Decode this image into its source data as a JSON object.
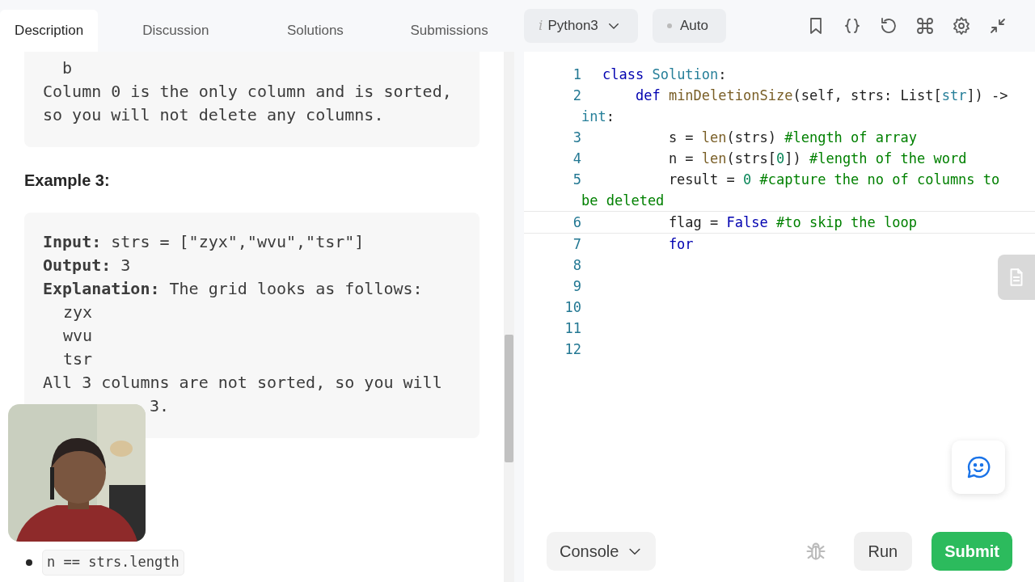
{
  "tabs": [
    {
      "label": "Description",
      "selected": true
    },
    {
      "label": "Discussion",
      "selected": false
    },
    {
      "label": "Solutions",
      "selected": false
    },
    {
      "label": "Submissions",
      "selected": false
    }
  ],
  "example_2_tail": [
    "  b",
    "Column 0 is the only column and is sorted,",
    "so you will not delete any columns."
  ],
  "example_3": {
    "heading": "Example 3:",
    "input_line": "**Input:** strs = [\"zyx\",\"wvu\",\"tsr\"]",
    "output_line": "**Output:** 3",
    "explanation_line": "**Explanation:** The grid looks as follows:",
    "grid": [
      "zyx",
      "wvu",
      "tsr"
    ],
    "note": "All 3 columns are not sorted, so you will",
    "note_tail": "3."
  },
  "constraints": [
    "n == strs.length"
  ],
  "webcam": {
    "kind": "picture"
  },
  "editor_toolbar": {
    "language_prefix": "i",
    "language": "Python3",
    "mode": "Auto"
  },
  "code": [
    {
      "number": "1",
      "current": false,
      "segments": [
        {
          "kind": "keyword",
          "text": "class "
        },
        {
          "kind": "type",
          "text": "Solution"
        },
        {
          "kind": "plain",
          "text": ":"
        }
      ]
    },
    {
      "number": "2",
      "current": false,
      "segments": [
        {
          "kind": "keyword",
          "text": "    def "
        },
        {
          "kind": "function",
          "text": "minDeletionSize"
        },
        {
          "kind": "plain",
          "text": "(self, strs: List["
        },
        {
          "kind": "type",
          "text": "str"
        },
        {
          "kind": "plain",
          "text": "]) ->"
        }
      ],
      "wrapped": [
        {
          "kind": "type",
          "text": "int"
        },
        {
          "kind": "plain",
          "text": ":"
        }
      ]
    },
    {
      "number": "3",
      "current": false,
      "segments": [
        {
          "kind": "plain",
          "text": "        s = "
        },
        {
          "kind": "function",
          "text": "len"
        },
        {
          "kind": "plain",
          "text": "(strs) "
        },
        {
          "kind": "comment",
          "text": "#length of array"
        }
      ]
    },
    {
      "number": "4",
      "current": false,
      "segments": [
        {
          "kind": "plain",
          "text": "        n = "
        },
        {
          "kind": "function",
          "text": "len"
        },
        {
          "kind": "plain",
          "text": "(strs["
        },
        {
          "kind": "number",
          "text": "0"
        },
        {
          "kind": "plain",
          "text": "]) "
        },
        {
          "kind": "comment",
          "text": "#length of the word"
        }
      ]
    },
    {
      "number": "5",
      "current": false,
      "segments": [
        {
          "kind": "plain",
          "text": "        result = "
        },
        {
          "kind": "number",
          "text": "0"
        },
        {
          "kind": "comment",
          "text": " #capture the no of columns to"
        }
      ],
      "wrapped": [
        {
          "kind": "comment",
          "text": "be deleted"
        }
      ]
    },
    {
      "number": "6",
      "current": true,
      "segments": [
        {
          "kind": "plain",
          "text": "        flag = "
        },
        {
          "kind": "keyword",
          "text": "False"
        },
        {
          "kind": "comment",
          "text": " #to skip the loop"
        }
      ]
    },
    {
      "number": "7",
      "current": false,
      "segments": [
        {
          "kind": "keyword",
          "text": "        for"
        }
      ]
    },
    {
      "number": "8",
      "current": false
    },
    {
      "number": "9",
      "current": false
    },
    {
      "number": "10",
      "current": false
    },
    {
      "number": "11",
      "current": false
    },
    {
      "number": "12",
      "current": false
    }
  ],
  "footer": {
    "console": "Console",
    "run": "Run",
    "submit": "Submit"
  }
}
